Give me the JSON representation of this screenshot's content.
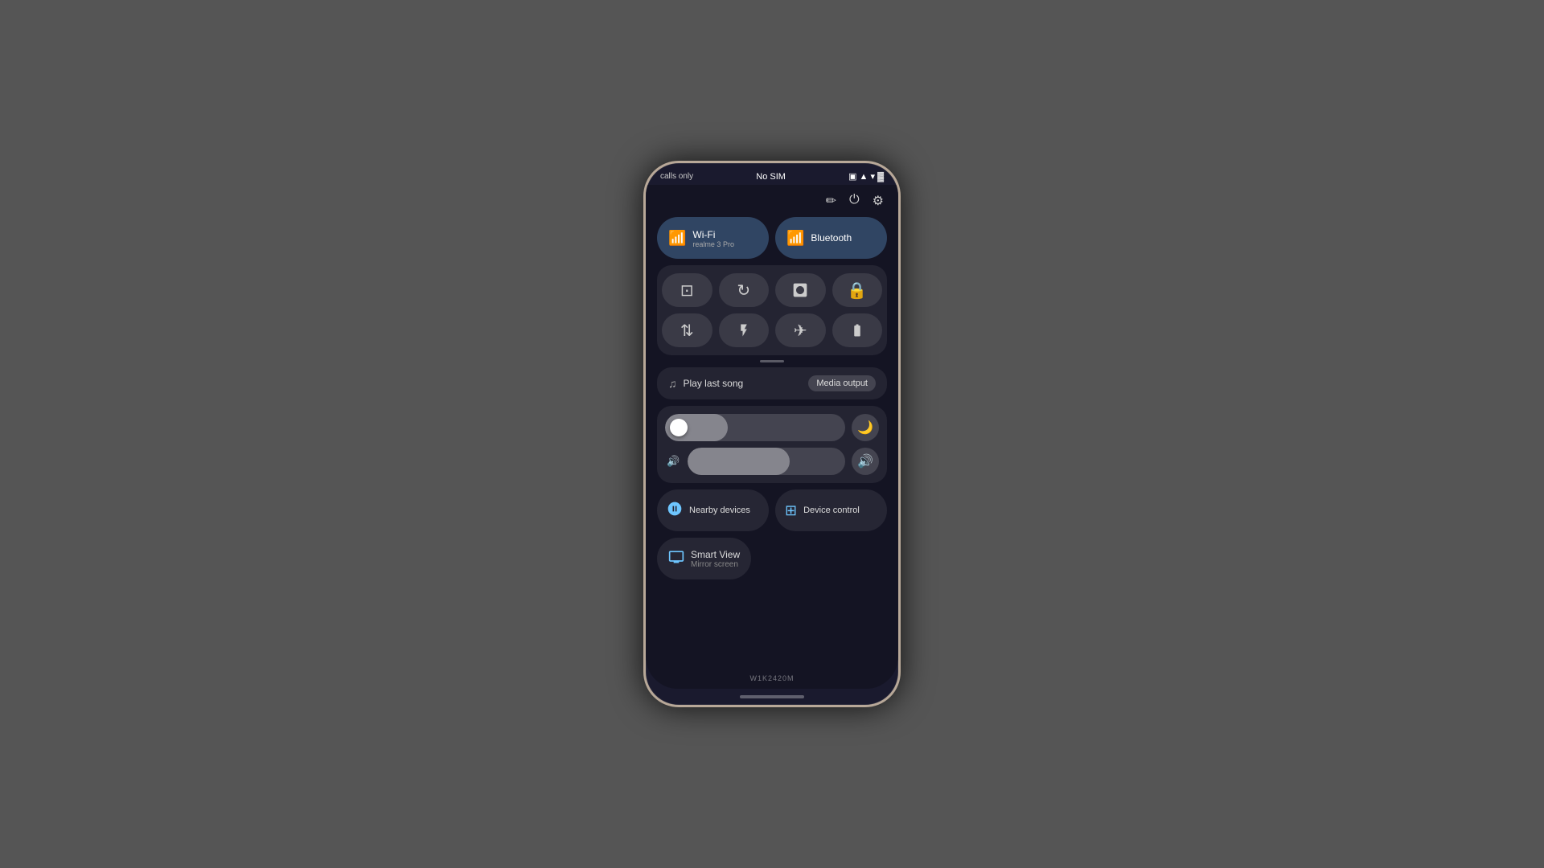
{
  "background": {
    "color": "#4d4d4d"
  },
  "status_bar": {
    "left": "calls only",
    "center": "No SIM",
    "icons": [
      "▣",
      "▲",
      "▌▌▌",
      "🔋"
    ]
  },
  "edit_icons": {
    "pencil": "✏",
    "power": "⏻",
    "settings": "⚙"
  },
  "toggles": {
    "wifi": {
      "label": "Wi-Fi",
      "sublabel": "realme 3 Pro",
      "icon": "wifi",
      "active": true
    },
    "bluetooth": {
      "label": "Bluetooth",
      "sublabel": "",
      "icon": "bluetooth",
      "active": true
    }
  },
  "quick_icons": [
    {
      "id": "screenshot",
      "icon": "⊡",
      "active": false
    },
    {
      "id": "rotate",
      "icon": "⟳",
      "active": false
    },
    {
      "id": "nfc",
      "icon": "⬡",
      "active": false
    },
    {
      "id": "lock",
      "icon": "🔒",
      "active": false
    },
    {
      "id": "data",
      "icon": "⇅",
      "active": false
    },
    {
      "id": "flashlight",
      "icon": "🔦",
      "active": false
    },
    {
      "id": "airplane",
      "icon": "✈",
      "active": false
    },
    {
      "id": "battery_saver",
      "icon": "🔋",
      "active": false
    }
  ],
  "media": {
    "icon": "♫",
    "label": "Play last song",
    "output_label": "Media output"
  },
  "brightness_slider": {
    "fill_percent": 35,
    "right_icon": "🌙"
  },
  "volume_slider": {
    "fill_percent": 65,
    "left_icon": "🔊",
    "right_icon": "🔊"
  },
  "bottom_buttons": [
    {
      "id": "nearby-devices",
      "icon": "⊙",
      "label": "Nearby devices"
    },
    {
      "id": "device-control",
      "icon": "⊞",
      "label": "Device control"
    }
  ],
  "smart_view": {
    "icon": "⊙",
    "label": "Smart View",
    "sublabel": "Mirror screen"
  },
  "model": "W1K2420M"
}
